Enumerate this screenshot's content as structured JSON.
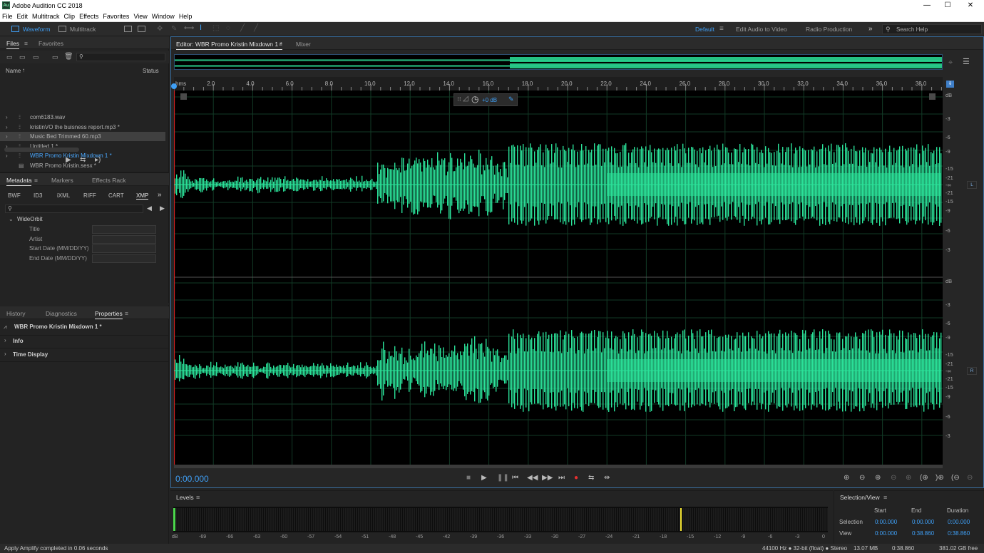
{
  "window": {
    "title": "Adobe Audition CC 2018",
    "icon_text": "Au",
    "minimize": "—",
    "maximize": "☐",
    "close": "✕"
  },
  "menu": [
    "File",
    "Edit",
    "Multitrack",
    "Clip",
    "Effects",
    "Favorites",
    "View",
    "Window",
    "Help"
  ],
  "toolbar": {
    "waveform_label": "Waveform",
    "multitrack_label": "Multitrack",
    "workspaces": [
      "Default",
      "Edit Audio to Video",
      "Radio Production"
    ],
    "more_icon": "»",
    "search_placeholder": "Search Help"
  },
  "files_panel": {
    "tabs": [
      "Files",
      "Favorites"
    ],
    "columns": {
      "name": "Name",
      "status": "Status"
    },
    "items": [
      {
        "name": "com6183.wav",
        "type": "audio",
        "selected": false,
        "active": false
      },
      {
        "name": "kristinVO the buisness report.mp3 *",
        "type": "audio",
        "selected": false,
        "active": false
      },
      {
        "name": "Music Bed Trimmed 60.mp3",
        "type": "audio",
        "selected": true,
        "active": false
      },
      {
        "name": "Untitled 1 *",
        "type": "audio",
        "selected": false,
        "active": false
      },
      {
        "name": "WBR Promo Kristin Mixdown 1 *",
        "type": "audio",
        "selected": false,
        "active": true
      },
      {
        "name": "WBR Promo Kristin.sesx *",
        "type": "session",
        "selected": false,
        "active": false
      }
    ]
  },
  "metadata_panel": {
    "tabs": [
      "Metadata",
      "Markers",
      "Effects Rack"
    ],
    "subtabs": [
      "BWF",
      "ID3",
      "iXML",
      "RIFF",
      "CART",
      "XMP"
    ],
    "more_icon": "»",
    "group": "WideOrbit",
    "fields": [
      {
        "label": "Title",
        "value": ""
      },
      {
        "label": "Artist",
        "value": ""
      },
      {
        "label": "Start Date (MM/DD/YY)",
        "value": ""
      },
      {
        "label": "End Date (MM/DD/YY)",
        "value": ""
      }
    ]
  },
  "properties_panel": {
    "tabs": [
      "History",
      "Diagnostics",
      "Properties"
    ],
    "file_name": "WBR Promo Kristin Mixdown 1 *",
    "sections": [
      "Info",
      "Time Display"
    ]
  },
  "editor": {
    "tabs": [
      "Editor: WBR Promo Kristin Mixdown 1 *",
      "Mixer"
    ],
    "hud_gain": "+0 dB",
    "ruler_unit": "hms",
    "ruler_labels": [
      "2.0",
      "4.0",
      "6.0",
      "8.0",
      "10.0",
      "12.0",
      "14.0",
      "16.0",
      "18.0",
      "20.0",
      "22.0",
      "24.0",
      "26.0",
      "28.0",
      "30.0",
      "32.0",
      "34.0",
      "36.0",
      "38.0"
    ],
    "db_scale": [
      "dB",
      "-3",
      "-6",
      "-9",
      "-15",
      "-21",
      "-∞",
      "-21",
      "-15",
      "-9",
      "-6",
      "-3"
    ],
    "channels": [
      "L",
      "R"
    ],
    "waveform_color": "#2be39a",
    "current_time": "0:00.000"
  },
  "levels_panel": {
    "title": "Levels",
    "scale": [
      "dB",
      "-69",
      "-66",
      "-63",
      "-60",
      "-57",
      "-54",
      "-51",
      "-48",
      "-45",
      "-42",
      "-39",
      "-36",
      "-33",
      "-30",
      "-27",
      "-24",
      "-21",
      "-18",
      "-15",
      "-12",
      "-9",
      "-6",
      "-3",
      "0"
    ]
  },
  "selection_view": {
    "title": "Selection/View",
    "columns": [
      "Start",
      "End",
      "Duration"
    ],
    "rows": [
      {
        "label": "Selection",
        "start": "0:00.000",
        "end": "0:00.000",
        "duration": "0:00.000"
      },
      {
        "label": "View",
        "start": "0:00.000",
        "end": "0:38.860",
        "duration": "0:38.860"
      }
    ]
  },
  "status": {
    "message": "Apply Amplify completed in 0.06 seconds",
    "format": "44100 Hz ● 32-bit (float) ● Stereo",
    "size": "13.07 MB",
    "duration": "0:38.860",
    "free": "381.02 GB free"
  }
}
